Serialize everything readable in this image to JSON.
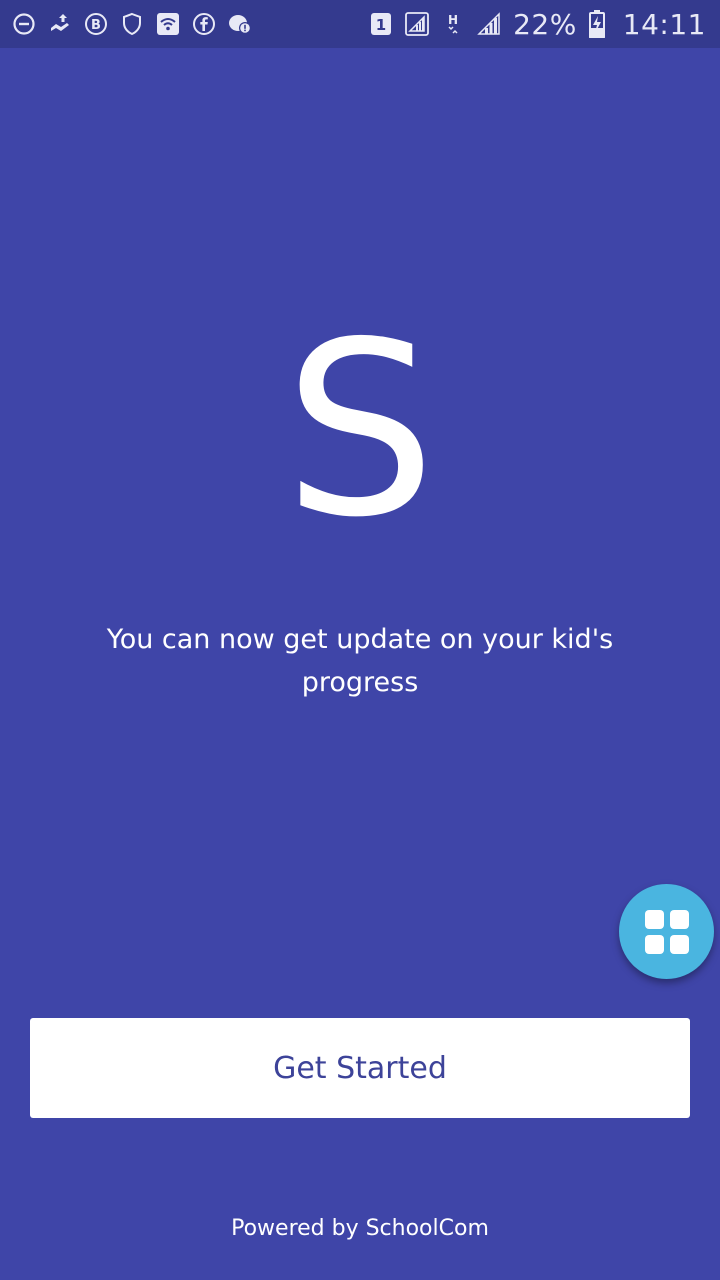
{
  "status_bar": {
    "left_icons": [
      "do-not-disturb-icon",
      "cloud-upload-icon",
      "b-badge-icon",
      "shield-icon",
      "wifi-box-icon",
      "facebook-icon",
      "chat-alert-icon"
    ],
    "right_icons": [
      "sim-1-icon",
      "signal-box-icon",
      "h-network-icon",
      "signal-icon",
      "battery-charging-icon"
    ],
    "battery_percent": "22%",
    "time": "14:11"
  },
  "logo": {
    "letter": "S"
  },
  "tagline": "You can now get update on your kid's progress",
  "fab": {
    "icon": "grid-icon",
    "color": "#4ab5e0"
  },
  "cta": {
    "label": "Get Started"
  },
  "footer": {
    "text": "Powered by SchoolCom"
  },
  "colors": {
    "background": "#3f45a8",
    "status_bar": "#343a8e",
    "button_text": "#3d4399"
  }
}
